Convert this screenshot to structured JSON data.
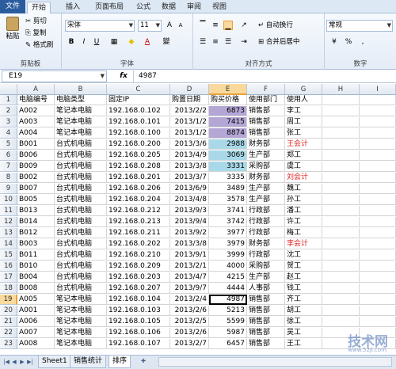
{
  "tabs": [
    "文件",
    "开始",
    "插入",
    "页面布局",
    "公式",
    "数据",
    "审阅",
    "视图"
  ],
  "ribbon": {
    "clipboard": {
      "paste": "粘贴",
      "cut": "剪切",
      "copy": "复制",
      "format_painter": "格式刷",
      "label": "剪贴板"
    },
    "font": {
      "name": "宋体",
      "size": "11",
      "label": "字体",
      "bold": "B",
      "italic": "I",
      "underline": "U",
      "grow": "A",
      "shrink": "A",
      "color": "A"
    },
    "alignment": {
      "wrap": "自动换行",
      "merge": "合并后居中",
      "label": "对齐方式"
    },
    "number": {
      "format": "常规",
      "label": "数字",
      "percent": "%",
      "comma": ","
    }
  },
  "formula_bar": {
    "name_box": "E19",
    "fx": "fx",
    "value": "4987"
  },
  "columns": [
    "A",
    "B",
    "C",
    "D",
    "E",
    "F",
    "G",
    "H",
    "I"
  ],
  "rows": [
    [
      "电脑编号",
      "电脑类型",
      "固定IP",
      "购置日期",
      "购买价格",
      "使用部门",
      "使用人"
    ],
    [
      "A002",
      "笔记本电脑",
      "192.168.0.102",
      "2013/2/2",
      "6873",
      "销售部",
      "李工"
    ],
    [
      "A003",
      "笔记本电脑",
      "192.168.0.101",
      "2013/1/2",
      "7415",
      "销售部",
      "周工"
    ],
    [
      "A004",
      "笔记本电脑",
      "192.168.0.100",
      "2013/1/2",
      "8874",
      "销售部",
      "张工"
    ],
    [
      "B001",
      "台式机电脑",
      "192.168.0.200",
      "2013/3/6",
      "2988",
      "财务部",
      "王会计"
    ],
    [
      "B006",
      "台式机电脑",
      "192.168.0.205",
      "2013/4/9",
      "3069",
      "生产部",
      "郑工"
    ],
    [
      "B009",
      "台式机电脑",
      "192.168.0.208",
      "2013/3/8",
      "3331",
      "采购部",
      "虞工"
    ],
    [
      "B002",
      "台式机电脑",
      "192.168.0.201",
      "2013/3/7",
      "3335",
      "财务部",
      "刘会计"
    ],
    [
      "B007",
      "台式机电脑",
      "192.168.0.206",
      "2013/6/9",
      "3489",
      "生产部",
      "魏工"
    ],
    [
      "B005",
      "台式机电脑",
      "192.168.0.204",
      "2013/4/8",
      "3578",
      "生产部",
      "孙工"
    ],
    [
      "B013",
      "台式机电脑",
      "192.168.0.212",
      "2013/9/3",
      "3741",
      "行政部",
      "潘工"
    ],
    [
      "B014",
      "台式机电脑",
      "192.168.0.213",
      "2013/9/4",
      "3742",
      "行政部",
      "许工"
    ],
    [
      "B012",
      "台式机电脑",
      "192.168.0.211",
      "2013/9/2",
      "3977",
      "行政部",
      "梅工"
    ],
    [
      "B003",
      "台式机电脑",
      "192.168.0.202",
      "2013/3/8",
      "3979",
      "财务部",
      "李会计"
    ],
    [
      "B011",
      "台式机电脑",
      "192.168.0.210",
      "2013/9/1",
      "3999",
      "行政部",
      "沈工"
    ],
    [
      "B010",
      "台式机电脑",
      "192.168.0.209",
      "2013/2/1",
      "4000",
      "采购部",
      "贺工"
    ],
    [
      "B004",
      "台式机电脑",
      "192.168.0.203",
      "2013/4/7",
      "4215",
      "生产部",
      "赵工"
    ],
    [
      "B008",
      "台式机电脑",
      "192.168.0.207",
      "2013/9/7",
      "4444",
      "人事部",
      "钱工"
    ],
    [
      "A005",
      "笔记本电脑",
      "192.168.0.104",
      "2013/2/4",
      "4987",
      "销售部",
      "齐工"
    ],
    [
      "A001",
      "笔记本电脑",
      "192.168.0.103",
      "2013/2/6",
      "5213",
      "销售部",
      "胡工"
    ],
    [
      "A006",
      "笔记本电脑",
      "192.168.0.105",
      "2013/2/5",
      "5599",
      "销售部",
      "徐工"
    ],
    [
      "A007",
      "笔记本电脑",
      "192.168.0.106",
      "2013/2/6",
      "5987",
      "销售部",
      "吴工"
    ],
    [
      "A008",
      "笔记本电脑",
      "192.168.0.107",
      "2013/2/7",
      "6457",
      "销售部",
      "王工"
    ]
  ],
  "sheets": [
    "Sheet1",
    "销售统计",
    "排序"
  ],
  "watermark": {
    "main": "技术网",
    "url": "www.52jl.com"
  },
  "colors": {
    "purple_fill": "#b4a7d6",
    "teal_fill": "#a9d9e8",
    "red_text": "#dd2222"
  }
}
